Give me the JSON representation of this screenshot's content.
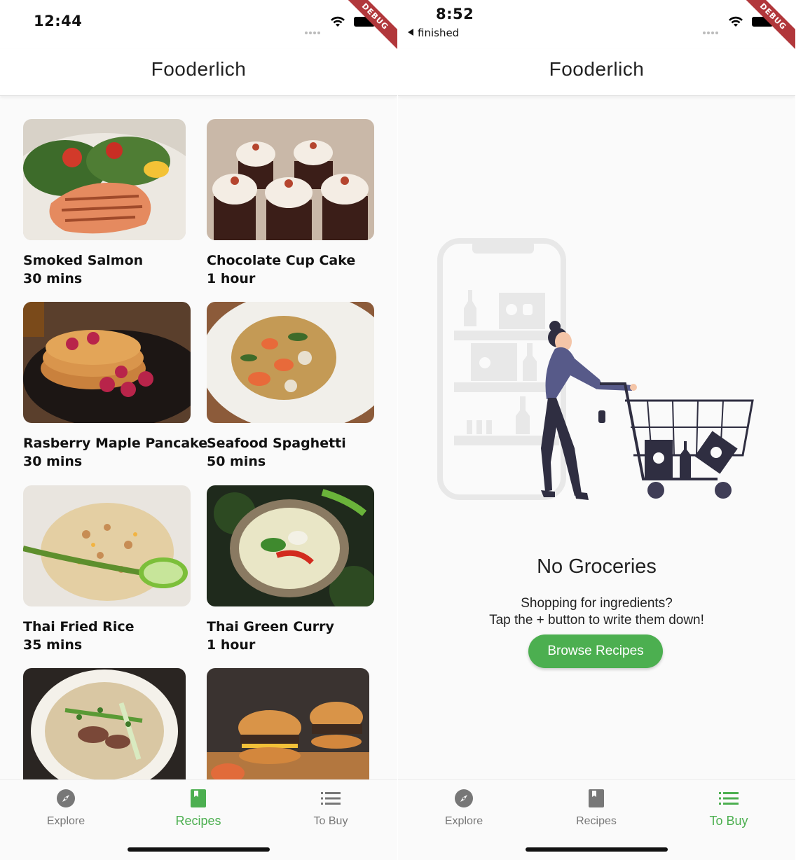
{
  "left_screen": {
    "status_time": "12:44",
    "debug_banner": "DEBUG",
    "app_title": "Fooderlich",
    "recipes": [
      {
        "name": "Smoked Salmon",
        "duration": "30 mins"
      },
      {
        "name": "Chocolate Cup Cake",
        "duration": "1 hour"
      },
      {
        "name": "Rasberry Maple Pancake",
        "duration": "30 mins"
      },
      {
        "name": "Seafood Spaghetti",
        "duration": "50 mins"
      },
      {
        "name": "Thai Fried Rice",
        "duration": "35 mins"
      },
      {
        "name": "Thai Green Curry",
        "duration": "1 hour"
      }
    ],
    "nav": [
      {
        "label": "Explore",
        "icon": "compass-icon",
        "active": false
      },
      {
        "label": "Recipes",
        "icon": "book-icon",
        "active": true
      },
      {
        "label": "To Buy",
        "icon": "list-icon",
        "active": false
      }
    ]
  },
  "right_screen": {
    "status_time": "8:52",
    "back_label": "finished",
    "debug_banner": "DEBUG",
    "app_title": "Fooderlich",
    "empty_title": "No Groceries",
    "empty_line1": "Shopping for ingredients?",
    "empty_line2": "Tap the + button to write them down!",
    "browse_button": "Browse Recipes",
    "nav": [
      {
        "label": "Explore",
        "icon": "compass-icon",
        "active": false
      },
      {
        "label": "Recipes",
        "icon": "book-icon",
        "active": false
      },
      {
        "label": "To Buy",
        "icon": "list-icon",
        "active": true
      }
    ]
  },
  "colors": {
    "accent": "#4caf50",
    "inactive": "#777777",
    "debug": "#b1373b"
  }
}
